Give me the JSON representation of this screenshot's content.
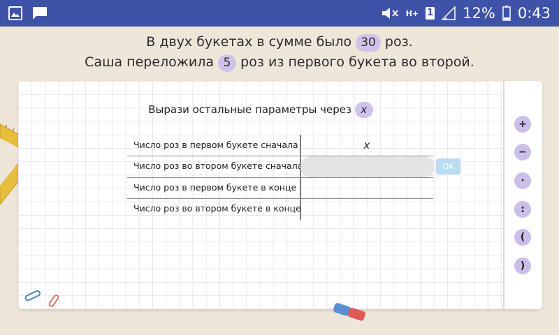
{
  "status_bar": {
    "battery": "12%",
    "time": "0:43",
    "network": "H+",
    "sim": "1"
  },
  "task": {
    "line1_before": "В двух букетах в сумме было",
    "line1_value": "30",
    "line1_after": "роз.",
    "line2_before": "Саша переложила",
    "line2_value": "5",
    "line2_after": "роз из первого букета во второй."
  },
  "board": {
    "instruction": "Вырази остальные параметры через",
    "variable": "x",
    "rows": [
      {
        "label": "Число роз в первом букете сначала",
        "value": "x"
      },
      {
        "label": "Число роз во втором букете сначала",
        "value": ""
      },
      {
        "label": "Число роз в первом букете в конце",
        "value": ""
      },
      {
        "label": "Число роз во втором букете в конце",
        "value": ""
      }
    ],
    "ok_label": "OK"
  },
  "operators": [
    "+",
    "−",
    "·",
    ":",
    "(",
    ")"
  ],
  "colors": {
    "status_bar": "#3e52a8",
    "background": "#efe6da",
    "accent_pill": "#cfc3ea",
    "ok_button": "#b9dcf0"
  }
}
